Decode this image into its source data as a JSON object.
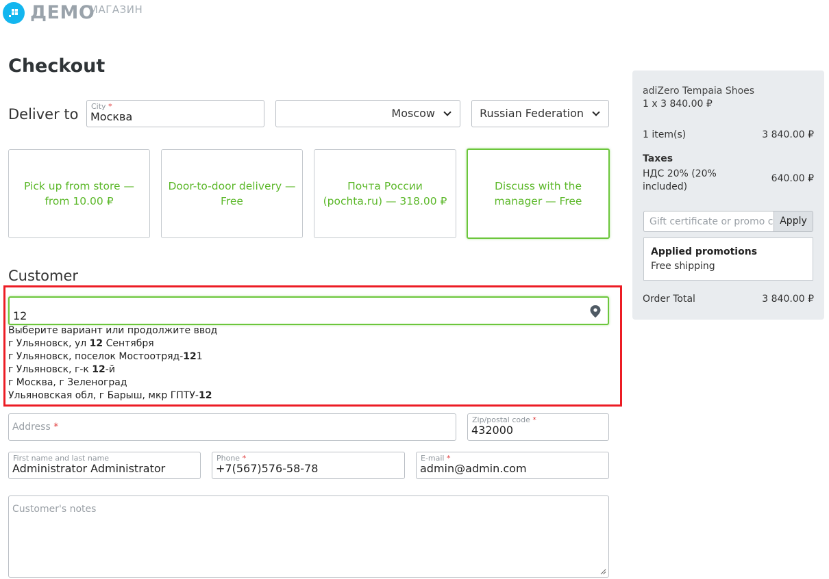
{
  "logo": {
    "brand": "ДЕМО",
    "sub": "МАГАЗИН"
  },
  "page": {
    "title": "Checkout"
  },
  "deliver": {
    "label": "Deliver to",
    "city_label": "City",
    "city_required": "*",
    "city_value": "Москва",
    "region_selected": "Moscow",
    "country_selected": "Russian Federation"
  },
  "shipping_methods": [
    {
      "label": "Pick up from store — from 10.00 ₽",
      "selected": false
    },
    {
      "label": "Door-to-door delivery — Free",
      "selected": false
    },
    {
      "label": "Почта России (pochta.ru) — 318.00 ₽",
      "selected": false
    },
    {
      "label": "Discuss with the manager — Free",
      "selected": true
    }
  ],
  "customer": {
    "title": "Customer",
    "address_search_value": "12",
    "suggestions_hint": "Выберите вариант или продолжите ввод",
    "suggestions": [
      {
        "before": "г Ульяновск, ул ",
        "bold": "12",
        "after": " Сентября"
      },
      {
        "before": "г Ульяновск, поселок Мостоотряд-",
        "bold": "12",
        "after": "1"
      },
      {
        "before": "г Ульяновск, г-к ",
        "bold": "12",
        "after": "-й"
      },
      {
        "before": "г Москва, г Зеленоград",
        "bold": "",
        "after": ""
      },
      {
        "before": "Ульяновская обл, г Барыш, мкр ГПТУ-",
        "bold": "12",
        "after": ""
      }
    ],
    "address_placeholder": "Address",
    "required_mark": "*",
    "zip_label": "Zip/postal code",
    "zip_value": "432000",
    "name_label": "First name and last name",
    "name_value": "Administrator Administrator",
    "phone_label": "Phone",
    "phone_value": "+7(567)576-58-78",
    "email_label": "E-mail",
    "email_value": "admin@admin.com",
    "notes_placeholder": "Customer's notes"
  },
  "summary": {
    "product_name": "adiZero Tempaia Shoes",
    "product_qty_price": "1 x 3 840.00 ₽",
    "items_label": "1 item(s)",
    "items_total": "3 840.00 ₽",
    "taxes_title": "Taxes",
    "tax_line1": "НДС 20% (20%",
    "tax_line2": "included)",
    "tax_value": "640.00 ₽",
    "promo_placeholder": "Gift certificate or promo code",
    "apply_label": "Apply",
    "promotions_title": "Applied promotions",
    "promotion_item": "Free shipping",
    "order_total_label": "Order Total",
    "order_total_value": "3 840.00 ₽"
  },
  "colors": {
    "accent_green": "#5cb82a",
    "highlight_red": "#ec1c24",
    "logo_blue": "#13b6ef",
    "panel_bg": "#e9ecef"
  }
}
